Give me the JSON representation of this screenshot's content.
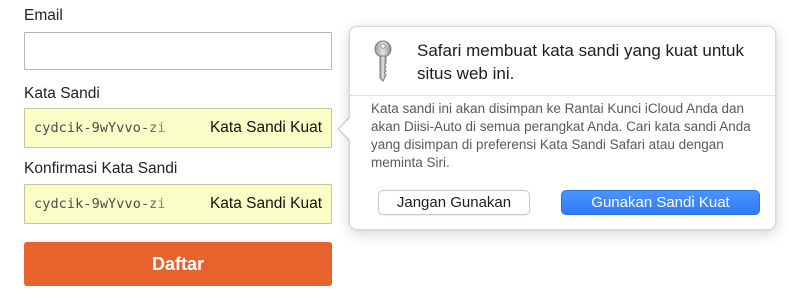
{
  "form": {
    "email_label": "Email",
    "email_value": "",
    "password_label": "Kata Sandi",
    "password_value": "cydcik-9wYvvo-zi",
    "password_strong_label": "Kata Sandi Kuat",
    "confirm_label": "Konfirmasi Kata Sandi",
    "confirm_value": "cydcik-9wYvvo-zi",
    "confirm_strong_label": "Kata Sandi Kuat",
    "submit_label": "Daftar"
  },
  "popover": {
    "icon": "key-icon",
    "title": "Safari membuat kata sandi yang kuat untuk situs web ini.",
    "body": "Kata sandi ini akan disimpan ke Rantai Kunci iCloud Anda dan akan Diisi-Auto di semua perangkat Anda. Cari kata sandi Anda yang disimpan di preferensi Kata Sandi Safari atau dengan meminta Siri.",
    "decline_label": "Jangan Gunakan",
    "accept_label": "Gunakan Sandi Kuat"
  },
  "colors": {
    "autofill_bg": "#fbfdc6",
    "submit_bg": "#e8622d",
    "primary_button": "#2f7cf6"
  }
}
